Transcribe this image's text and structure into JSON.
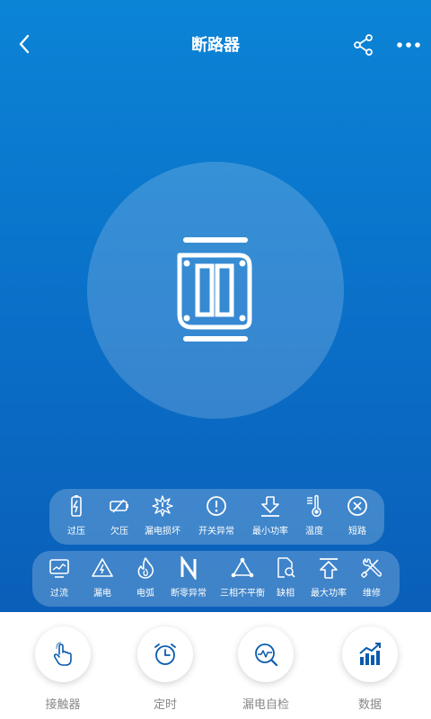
{
  "header": {
    "title": "断路器"
  },
  "status_row_1": [
    {
      "label": "过压",
      "icon": "battery-bolt-icon"
    },
    {
      "label": "欠压",
      "icon": "battery-low-icon"
    },
    {
      "label": "漏电损坏",
      "icon": "spark-damage-icon"
    },
    {
      "label": "开关异常",
      "icon": "alert-circle-icon"
    },
    {
      "label": "最小功率",
      "icon": "download-arrow-icon"
    },
    {
      "label": "温度",
      "icon": "thermometer-icon"
    },
    {
      "label": "短路",
      "icon": "close-circle-icon"
    }
  ],
  "status_row_2": [
    {
      "label": "过流",
      "icon": "monitor-wave-icon"
    },
    {
      "label": "漏电",
      "icon": "warning-bolt-icon"
    },
    {
      "label": "电弧",
      "icon": "flame-icon"
    },
    {
      "label": "断零异常",
      "icon": "letter-n-icon"
    },
    {
      "label": "三相不平衡",
      "icon": "triangle-nodes-icon"
    },
    {
      "label": "缺相",
      "icon": "document-search-icon"
    },
    {
      "label": "最大功率",
      "icon": "upload-arrow-icon"
    },
    {
      "label": "维修",
      "icon": "tools-icon"
    }
  ],
  "actions": [
    {
      "label": "接触器",
      "icon": "touch-hand-icon"
    },
    {
      "label": "定时",
      "icon": "alarm-clock-icon"
    },
    {
      "label": "漏电自检",
      "icon": "wave-search-icon"
    },
    {
      "label": "数据",
      "icon": "bar-chart-trend-icon"
    }
  ],
  "colors": {
    "primary": "#0a6ec7",
    "accent": "#0a5cae",
    "label_gray": "#888888"
  }
}
